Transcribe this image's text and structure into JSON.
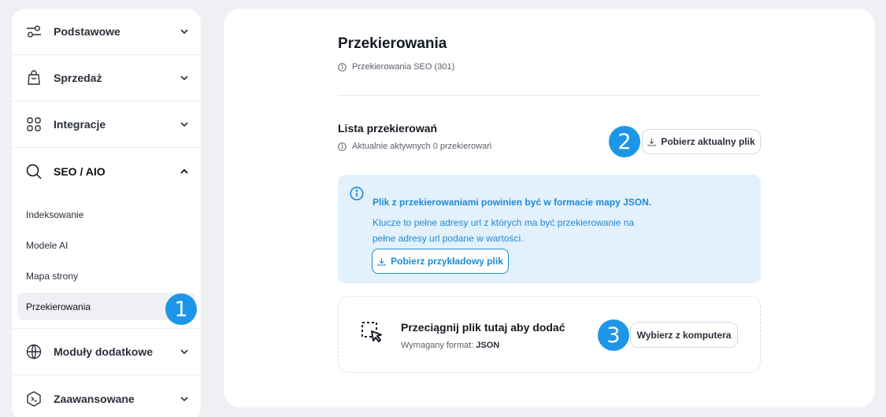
{
  "sidebar": {
    "items": [
      {
        "label": "Podstawowe",
        "icon": "sliders-icon"
      },
      {
        "label": "Sprzedaż",
        "icon": "bag-icon"
      },
      {
        "label": "Integracje",
        "icon": "grid-icon"
      },
      {
        "label": "SEO / AIO",
        "icon": "search-icon",
        "expanded": true
      }
    ],
    "sub_items": [
      {
        "label": "Indeksowanie"
      },
      {
        "label": "Modele AI"
      },
      {
        "label": "Mapa strony"
      },
      {
        "label": "Przekierowania",
        "active": true
      }
    ],
    "bottom_items": [
      {
        "label": "Moduły dodatkowe",
        "icon": "globe-icon"
      },
      {
        "label": "Zaawansowane",
        "icon": "code-hex-icon"
      }
    ]
  },
  "badges": {
    "one": "1",
    "two": "2",
    "three": "3"
  },
  "main": {
    "title": "Przekierowania",
    "subtitle": "Przekierowania SEO (301)",
    "section_title": "Lista przekierowań",
    "section_sub": "Aktualnie aktywnych 0 przekierowań",
    "download_current_label": "Pobierz aktualny plik",
    "info": {
      "line1": "Plik z przekierowaniami powinien być w formacie mapy JSON.",
      "line2": "Klucze to pełne adresy url z których ma być przekierowanie na",
      "line3": "pełne adresy url podane w wartości.",
      "sample_button": "Pobierz przykładowy plik"
    },
    "drop": {
      "title": "Przeciągnij plik tutaj aby dodać",
      "format_prefix": "Wymagany format:",
      "format_value": "JSON",
      "choose_button": "Wybierz z komputera"
    }
  },
  "colors": {
    "accent": "#1e96e8",
    "info_bg": "#e3f1fc",
    "info_text": "#1e8ad6",
    "page_bg": "#eef0f4"
  }
}
